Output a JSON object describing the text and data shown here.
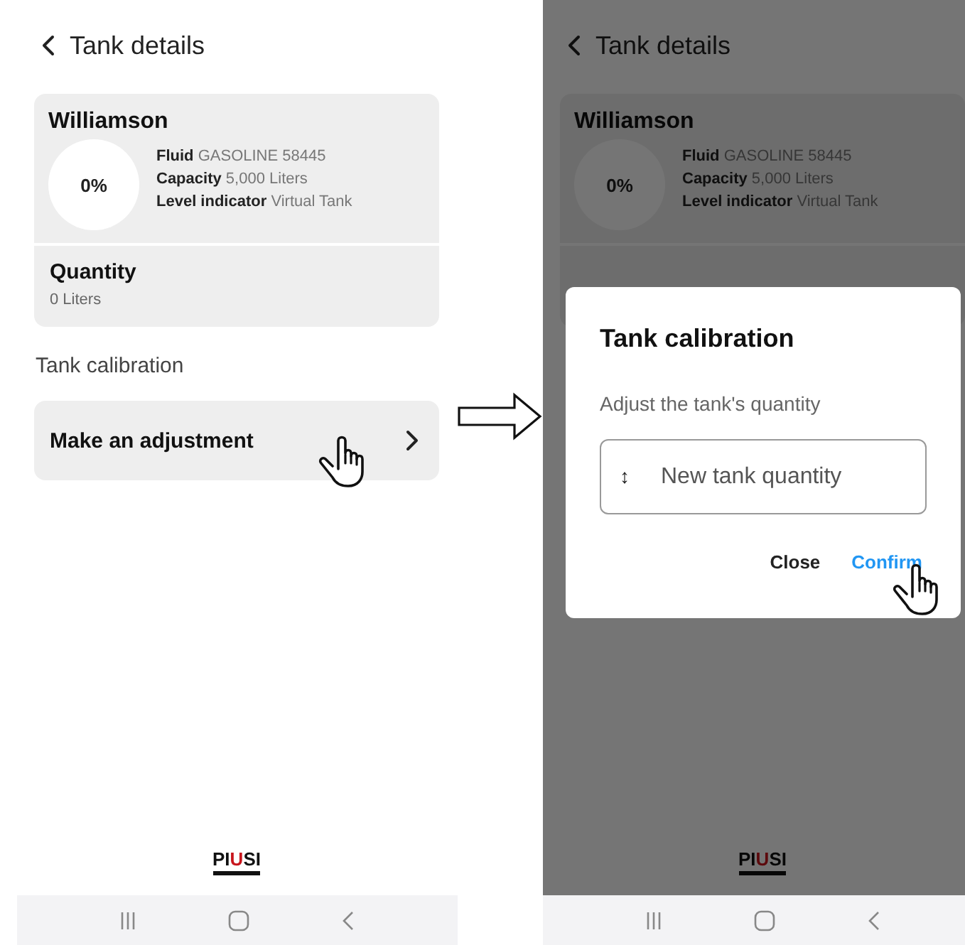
{
  "screens": [
    {
      "dimmed": false,
      "header": {
        "title": "Tank details"
      },
      "tank": {
        "name": "Williamson",
        "percent": "0%",
        "details": [
          {
            "label": "Fluid",
            "value": "GASOLINE 58445"
          },
          {
            "label": "Capacity",
            "value": "5,000 Liters"
          },
          {
            "label": "Level indicator",
            "value": "Virtual Tank"
          }
        ]
      },
      "quantity": {
        "label": "Quantity",
        "value": "0 Liters"
      },
      "section_label": "Tank calibration",
      "action": {
        "label": "Make an adjustment",
        "hand_cursor": true
      },
      "logo": [
        {
          "text": "PI",
          "accent": false
        },
        {
          "text": "U",
          "accent": true
        },
        {
          "text": "SI",
          "accent": false
        }
      ]
    },
    {
      "dimmed": true,
      "header": {
        "title": "Tank details"
      },
      "tank": {
        "name": "Williamson",
        "percent": "0%",
        "details": [
          {
            "label": "Fluid",
            "value": "GASOLINE 58445"
          },
          {
            "label": "Capacity",
            "value": "5,000 Liters"
          },
          {
            "label": "Level indicator",
            "value": "Virtual Tank"
          }
        ]
      },
      "logo": [
        {
          "text": "PI",
          "accent": false
        },
        {
          "text": "U",
          "accent": true
        },
        {
          "text": "SI",
          "accent": false
        }
      ],
      "dialog": {
        "title": "Tank calibration",
        "prompt": "Adjust the tank's quantity",
        "input": {
          "icon": "↕",
          "placeholder": "New tank quantity"
        },
        "buttons": [
          {
            "label": "Close",
            "kind": "plain"
          },
          {
            "label": "Confirm",
            "kind": "primary",
            "hand_cursor": true
          }
        ]
      }
    }
  ]
}
